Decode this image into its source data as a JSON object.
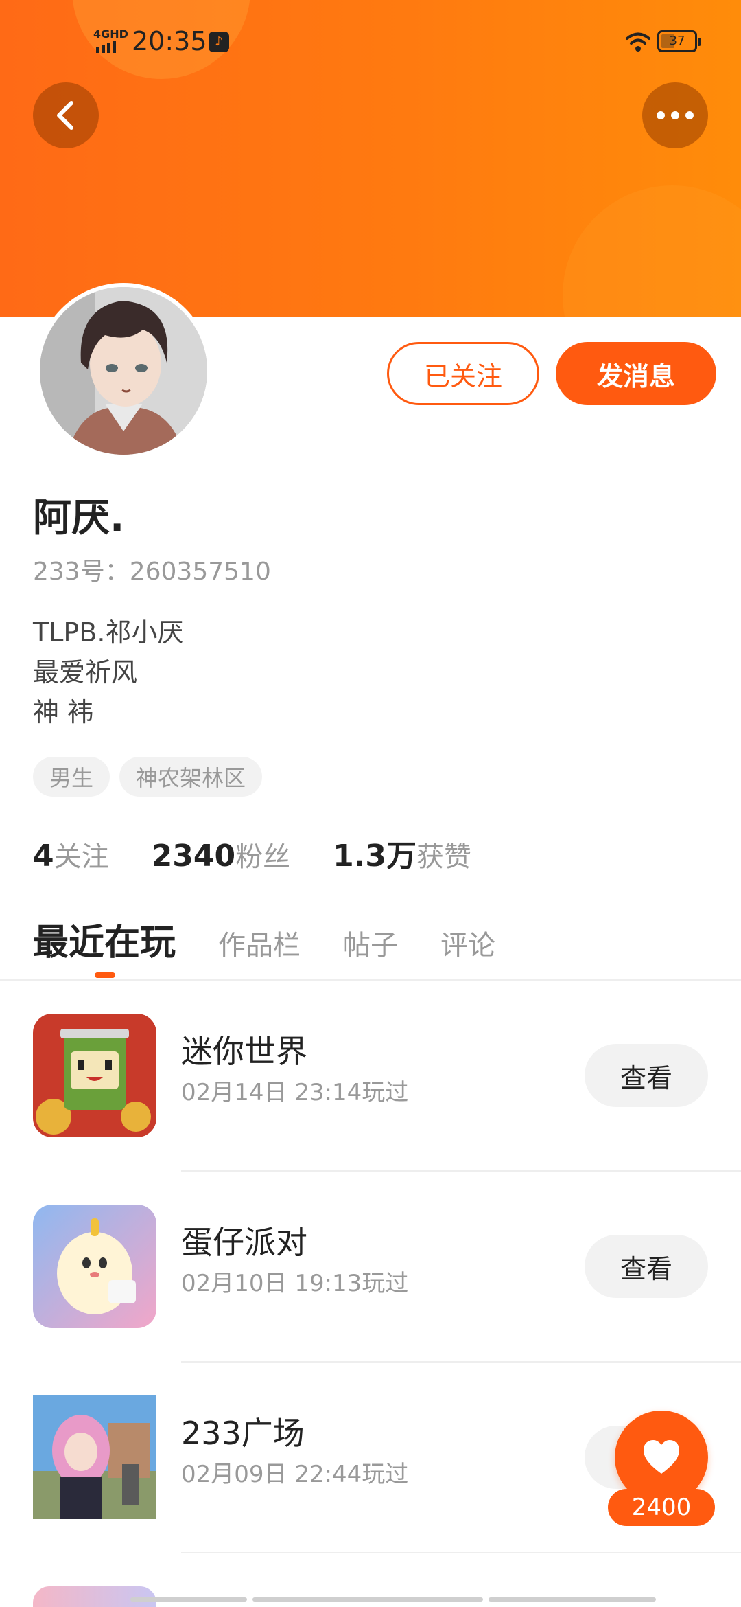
{
  "status_bar": {
    "network": "4GHD",
    "time": "20:35",
    "battery": "37",
    "app_icon": "music-note-icon"
  },
  "header": {
    "back_icon": "chevron-left-icon",
    "more_icon": "more-dots-icon",
    "background_color": "#ff7510"
  },
  "profile": {
    "name": "阿厌.",
    "uid": "233号：260357510",
    "bio": [
      "TLPB.祁小厌",
      "最爱祈风",
      "神 袆"
    ],
    "tags": [
      "男生",
      "神农架林区"
    ],
    "follow_label": "已关注",
    "message_label": "发消息"
  },
  "stats": [
    {
      "num": "4",
      "label": "关注"
    },
    {
      "num": "2340",
      "label": "粉丝"
    },
    {
      "num": "1.3万",
      "label": "获赞"
    }
  ],
  "tabs": [
    {
      "label": "最近在玩",
      "active": true
    },
    {
      "label": "作品栏",
      "active": false
    },
    {
      "label": "帖子",
      "active": false
    },
    {
      "label": "评论",
      "active": false
    }
  ],
  "games": [
    {
      "title": "迷你世界",
      "time": "02月14日 23:14玩过",
      "button": "查看"
    },
    {
      "title": "蛋仔派对",
      "time": "02月10日 19:13玩过",
      "button": "查看"
    },
    {
      "title": "233广场",
      "time": "02月09日 22:44玩过",
      "button": "查看"
    }
  ],
  "like": {
    "count": "2400",
    "icon": "heart-icon"
  },
  "colors": {
    "accent": "#ff5a10",
    "muted": "#999999"
  }
}
